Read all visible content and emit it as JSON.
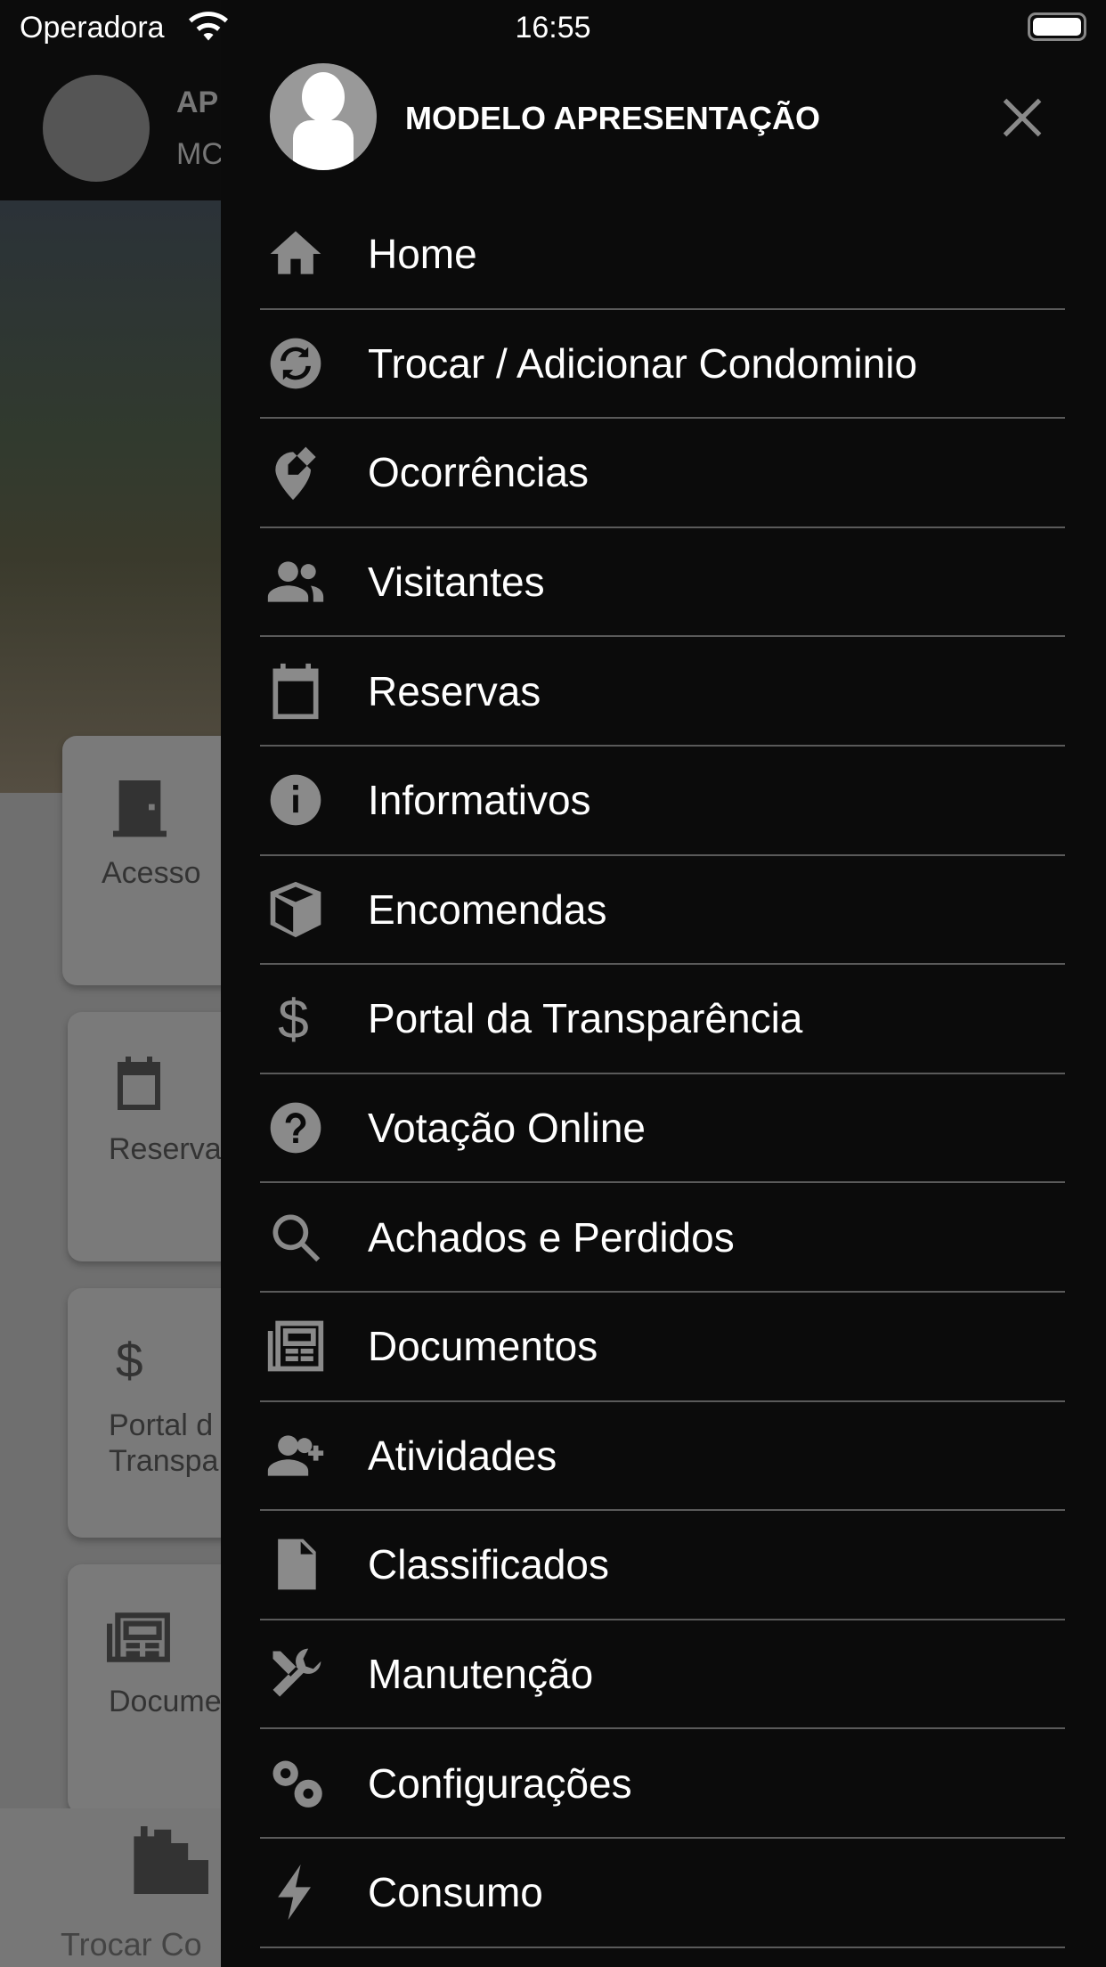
{
  "status_bar": {
    "carrier": "Operadora",
    "time": "16:55"
  },
  "background": {
    "header_line1": "AP",
    "header_line2": "MC",
    "cards": [
      "Acesso",
      "Reserva",
      "Portal d",
      "Transpa",
      "Docume"
    ],
    "bottom_nav_label": "Trocar Co"
  },
  "drawer": {
    "title": "MODELO APRESENTAÇÃO",
    "items": [
      {
        "label": "Home",
        "icon": "home-icon"
      },
      {
        "label": "Trocar / Adicionar Condominio",
        "icon": "swap-icon"
      },
      {
        "label": "Ocorrências",
        "icon": "pin-edit-icon"
      },
      {
        "label": "Visitantes",
        "icon": "people-icon"
      },
      {
        "label": "Reservas",
        "icon": "calendar-icon"
      },
      {
        "label": "Informativos",
        "icon": "info-icon"
      },
      {
        "label": "Encomendas",
        "icon": "box-icon"
      },
      {
        "label": "Portal da Transparência",
        "icon": "dollar-icon"
      },
      {
        "label": "Votação Online",
        "icon": "question-icon"
      },
      {
        "label": "Achados e Perdidos",
        "icon": "search-icon"
      },
      {
        "label": "Documentos",
        "icon": "newspaper-icon"
      },
      {
        "label": "Atividades",
        "icon": "person-add-icon"
      },
      {
        "label": "Classificados",
        "icon": "document-icon"
      },
      {
        "label": "Manutenção",
        "icon": "tools-icon"
      },
      {
        "label": "Configurações",
        "icon": "gears-icon"
      },
      {
        "label": "Consumo",
        "icon": "bolt-icon"
      }
    ]
  }
}
